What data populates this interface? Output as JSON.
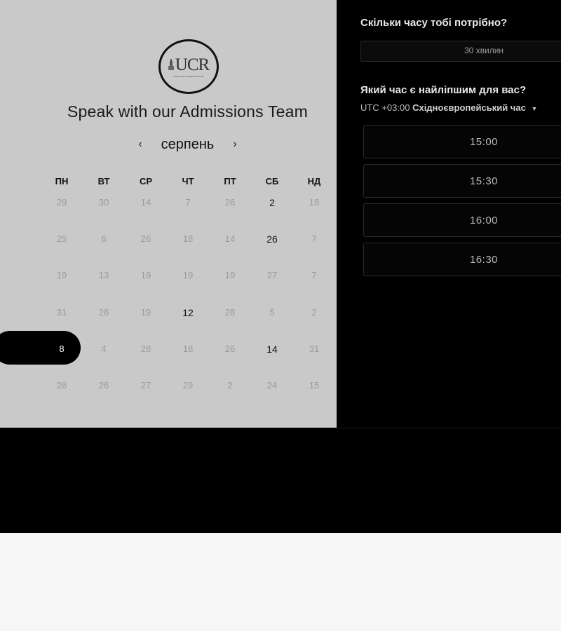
{
  "logo": {
    "text": "UCR",
    "subtext": "University College Riverside"
  },
  "heading": "Speak with our Admissions Team",
  "calendar": {
    "month": "серпень",
    "prev_symbol": "‹",
    "next_symbol": "›",
    "weekdays": [
      "ПН",
      "ВТ",
      "СР",
      "ЧТ",
      "ПТ",
      "СБ",
      "НД"
    ],
    "weeks": [
      [
        "29",
        "30",
        "14",
        "7",
        "26",
        "2",
        "18"
      ],
      [
        "25",
        "6",
        "26",
        "18",
        "14",
        "26",
        "7"
      ],
      [
        "19",
        "13",
        "19",
        "19",
        "19",
        "27",
        "7"
      ],
      [
        "31",
        "26",
        "19",
        "12",
        "28",
        "5",
        "2"
      ],
      [
        "8",
        "4",
        "28",
        "18",
        "26",
        "14",
        "31"
      ],
      [
        "26",
        "26",
        "27",
        "29",
        "2",
        "24",
        "15"
      ]
    ],
    "active_days": [
      [
        0,
        5
      ],
      [
        1,
        5
      ],
      [
        3,
        3
      ],
      [
        4,
        5
      ]
    ],
    "selected_day": [
      4,
      0
    ]
  },
  "booking": {
    "duration_question": "Скільки часу тобі потрібно?",
    "duration_value": "30 хвилин",
    "time_question": "Який час є найліпшим для вас?",
    "timezone_offset": "UTC +03:00",
    "timezone_name": "Східноєвропейський час",
    "slots": [
      "15:00",
      "15:30",
      "16:00",
      "16:30"
    ]
  }
}
